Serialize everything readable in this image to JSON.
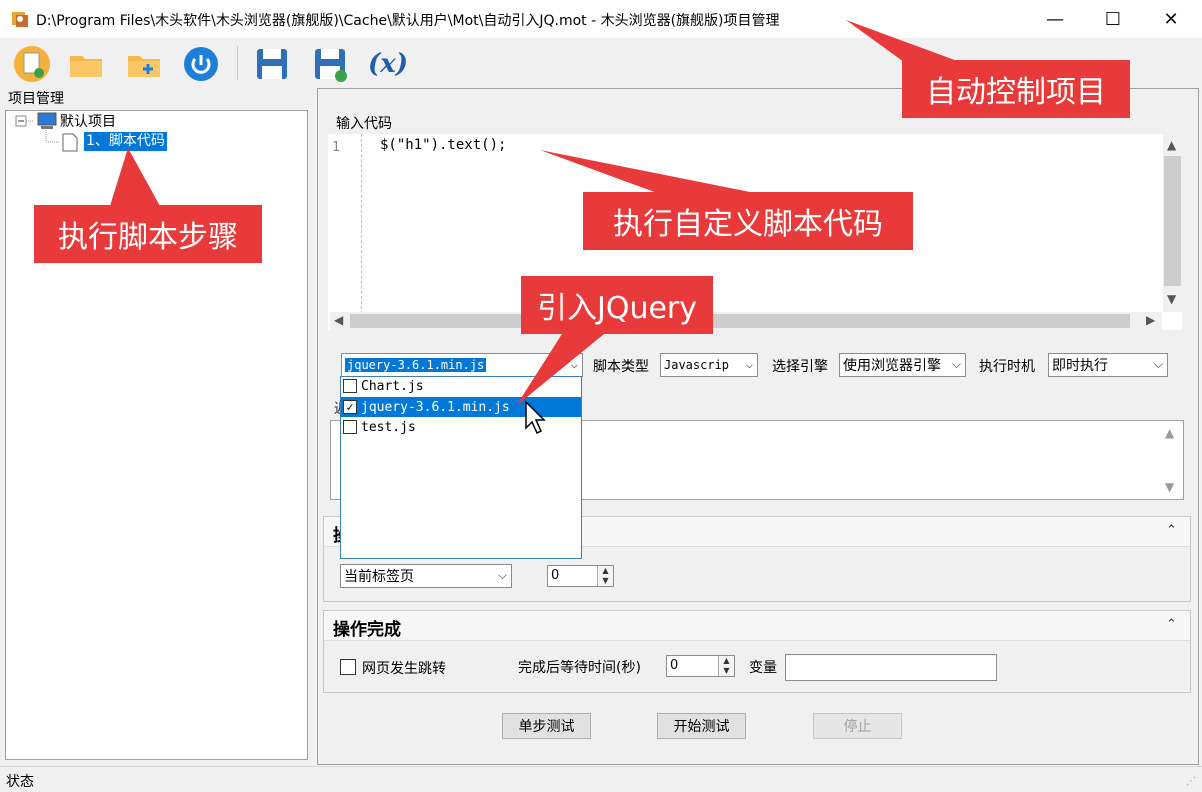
{
  "window": {
    "title": "D:\\Program Files\\木头软件\\木头浏览器(旗舰版)\\Cache\\默认用户\\Mot\\自动引入JQ.mot  - 木头浏览器(旗舰版)项目管理",
    "minimize": "—",
    "maximize": "☐",
    "close": "✕"
  },
  "toolbar": {
    "icons": [
      "new-project-icon",
      "open-folder-icon",
      "add-folder-icon",
      "power-icon",
      "save-icon",
      "save-as-icon",
      "variable-icon"
    ],
    "variable_label": "(x)"
  },
  "left_panel": {
    "group_label": "项目管理",
    "tree": {
      "root": "默认项目",
      "child": "1、脚本代码"
    }
  },
  "code_section": {
    "group_label": "输入代码",
    "line_number": "1",
    "code": "$(\"h1\").text();"
  },
  "controls": {
    "script_select": "jquery-3.6.1.min.js",
    "script_type_label": "脚本类型",
    "script_type_value": "Javascrip",
    "engine_label": "选择引擎",
    "engine_value": "使用浏览器引擎",
    "timing_label": "执行时机",
    "timing_value": "即时执行"
  },
  "script_list": [
    {
      "name": "Chart.js",
      "checked": false,
      "selected": false
    },
    {
      "name": "jquery-3.6.1.min.js",
      "checked": true,
      "selected": true
    },
    {
      "name": "test.js",
      "checked": false,
      "selected": false
    }
  ],
  "hidden_label_fragment": "返",
  "operation_section": {
    "title_fragment": "操",
    "tab_select": "当前标签页",
    "number_value": "0"
  },
  "complete_section": {
    "title": "操作完成",
    "redirect_label": "网页发生跳转",
    "wait_label": "完成后等待时间(秒)",
    "wait_value": "0",
    "var_label": "变量",
    "var_value": ""
  },
  "buttons": {
    "step_test": "单步测试",
    "start_test": "开始测试",
    "stop": "停止"
  },
  "status": {
    "text": "状态"
  },
  "annotations": {
    "auto_control": "自动控制项目",
    "exec_steps": "执行脚本步骤",
    "custom_code": "执行自定义脚本代码",
    "import_jquery": "引入JQuery"
  },
  "colors": {
    "callout": "#e83a3a",
    "selection": "#0078d7",
    "accent_blue": "#1f7fd8"
  }
}
